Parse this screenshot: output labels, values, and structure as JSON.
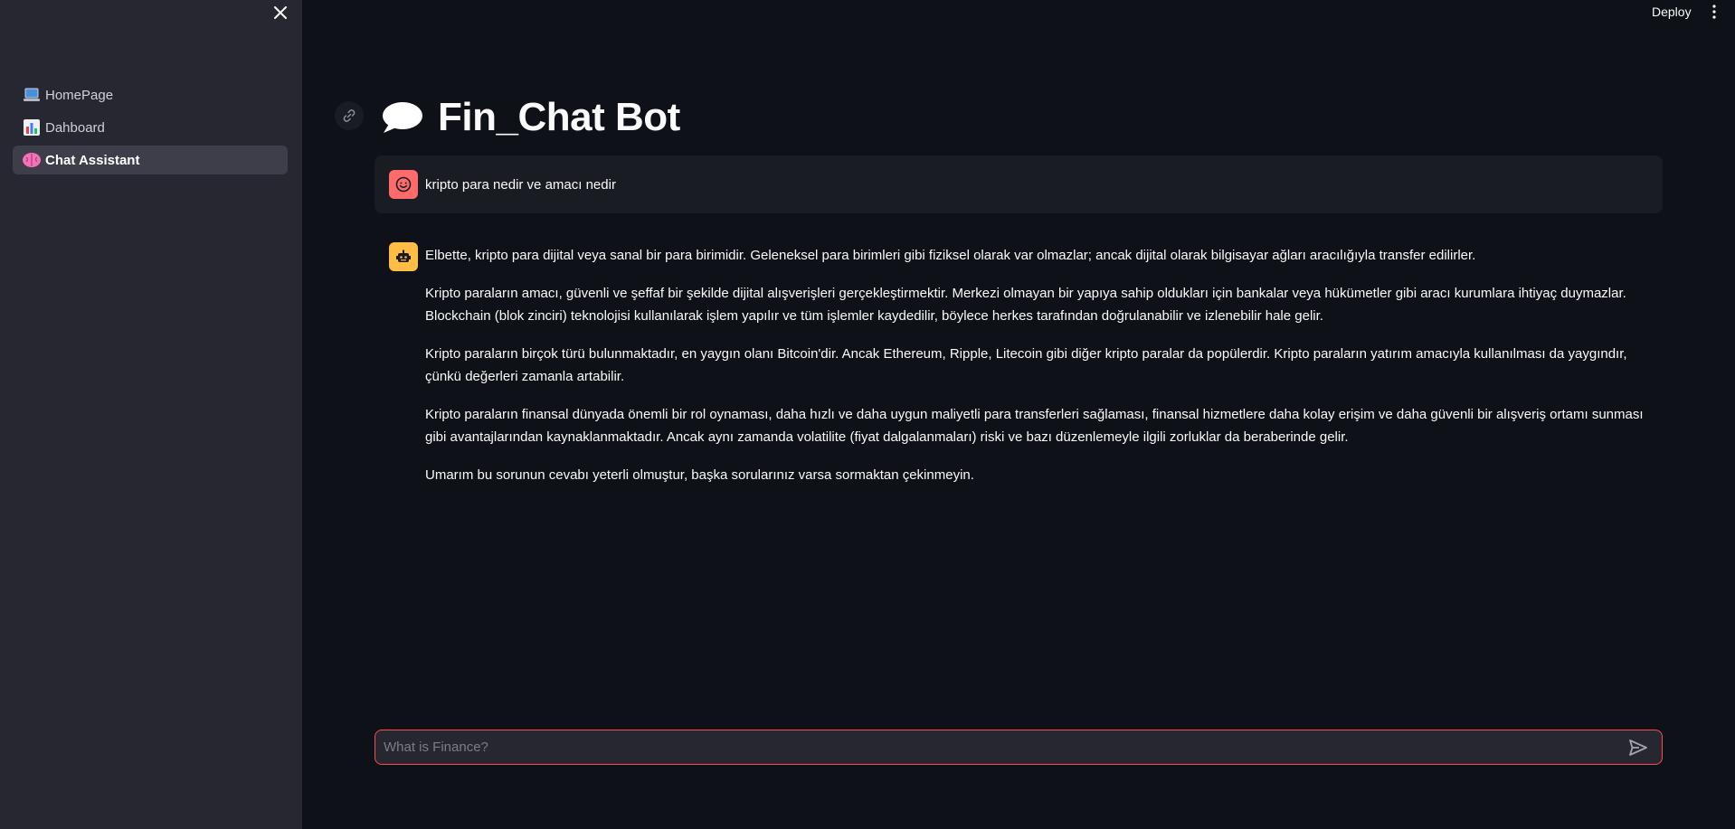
{
  "sidebar": {
    "items": [
      {
        "label": "HomePage",
        "icon": "laptop-icon",
        "active": false
      },
      {
        "label": "Dahboard",
        "icon": "bar-chart-icon",
        "active": false
      },
      {
        "label": "Chat Assistant",
        "icon": "brain-icon",
        "active": true
      }
    ]
  },
  "header": {
    "deploy_label": "Deploy"
  },
  "main": {
    "title": "Fin_Chat Bot",
    "title_icon": "speech-bubble-icon"
  },
  "chat": {
    "user_message": "kripto para nedir ve amacı nedir",
    "bot_paragraphs": [
      "Elbette, kripto para dijital veya sanal bir para birimidir. Geleneksel para birimleri gibi fiziksel olarak var olmazlar; ancak dijital olarak bilgisayar ağları aracılığıyla transfer edilirler.",
      "Kripto paraların amacı, güvenli ve şeffaf bir şekilde dijital alışverişleri gerçekleştirmektir. Merkezi olmayan bir yapıya sahip oldukları için bankalar veya hükümetler gibi aracı kurumlara ihtiyaç duymazlar. Blockchain (blok zinciri) teknolojisi kullanılarak işlem yapılır ve tüm işlemler kaydedilir, böylece herkes tarafından doğrulanabilir ve izlenebilir hale gelir.",
      "Kripto paraların birçok türü bulunmaktadır, en yaygın olanı Bitcoin'dir. Ancak Ethereum, Ripple, Litecoin gibi diğer kripto paralar da popülerdir. Kripto paraların yatırım amacıyla kullanılması da yaygındır, çünkü değerleri zamanla artabilir.",
      "Kripto paraların finansal dünyada önemli bir rol oynaması, daha hızlı ve daha uygun maliyetli para transferleri sağlaması, finansal hizmetlere daha kolay erişim ve daha güvenli bir alışveriş ortamı sunması gibi avantajlarından kaynaklanmaktadır. Ancak aynı zamanda volatilite (fiyat dalgalanmaları) riski ve bazı düzenlemeyle ilgili zorluklar da beraberinde gelir.",
      "Umarım bu sorunun cevabı yeterli olmuştur, başka sorularınız varsa sormaktan çekinmeyin."
    ],
    "input_placeholder": "What is Finance?",
    "input_value": ""
  },
  "colors": {
    "background": "#0e1117",
    "sidebar": "#262730",
    "accent": "#ff4b4b",
    "user_avatar": "#ff6b6b",
    "bot_avatar": "#ffbd45"
  }
}
